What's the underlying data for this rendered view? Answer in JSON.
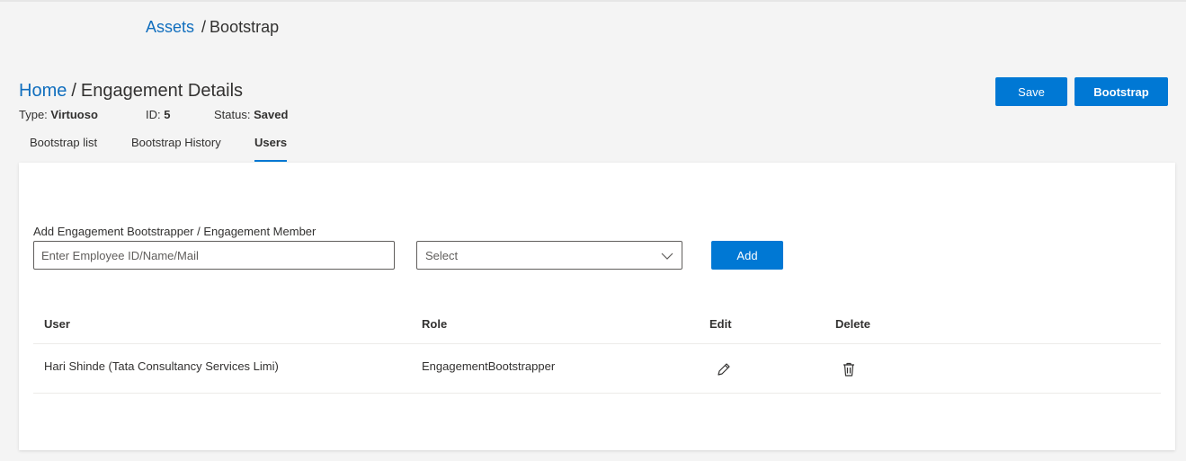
{
  "top_breadcrumb": {
    "link": "Assets",
    "separator": "/",
    "current": "Bootstrap"
  },
  "page_breadcrumb": {
    "link": "Home",
    "separator": "/",
    "current": "Engagement Details"
  },
  "meta": {
    "type_label": "Type:",
    "type_value": "Virtuoso",
    "id_label": "ID:",
    "id_value": "5",
    "status_label": "Status:",
    "status_value": "Saved"
  },
  "actions": {
    "save_label": "Save",
    "bootstrap_label": "Bootstrap"
  },
  "tabs": [
    {
      "label": "Bootstrap list",
      "active": false
    },
    {
      "label": "Bootstrap History",
      "active": false
    },
    {
      "label": "Users",
      "active": true
    }
  ],
  "add_form": {
    "label": "Add Engagement Bootstrapper / Engagement Member",
    "input_placeholder": "Enter Employee ID/Name/Mail",
    "input_value": "",
    "select_value": "Select",
    "add_label": "Add"
  },
  "table": {
    "headers": {
      "user": "User",
      "role": "Role",
      "edit": "Edit",
      "delete": "Delete"
    },
    "rows": [
      {
        "user": "Hari Shinde (Tata Consultancy Services Limi)",
        "role": "EngagementBootstrapper",
        "edit_icon": "pencil-icon",
        "delete_icon": "trash-icon"
      }
    ]
  },
  "colors": {
    "accent": "#0078d4",
    "link": "#106ebe",
    "background": "#f4f4f4",
    "text": "#323130"
  }
}
